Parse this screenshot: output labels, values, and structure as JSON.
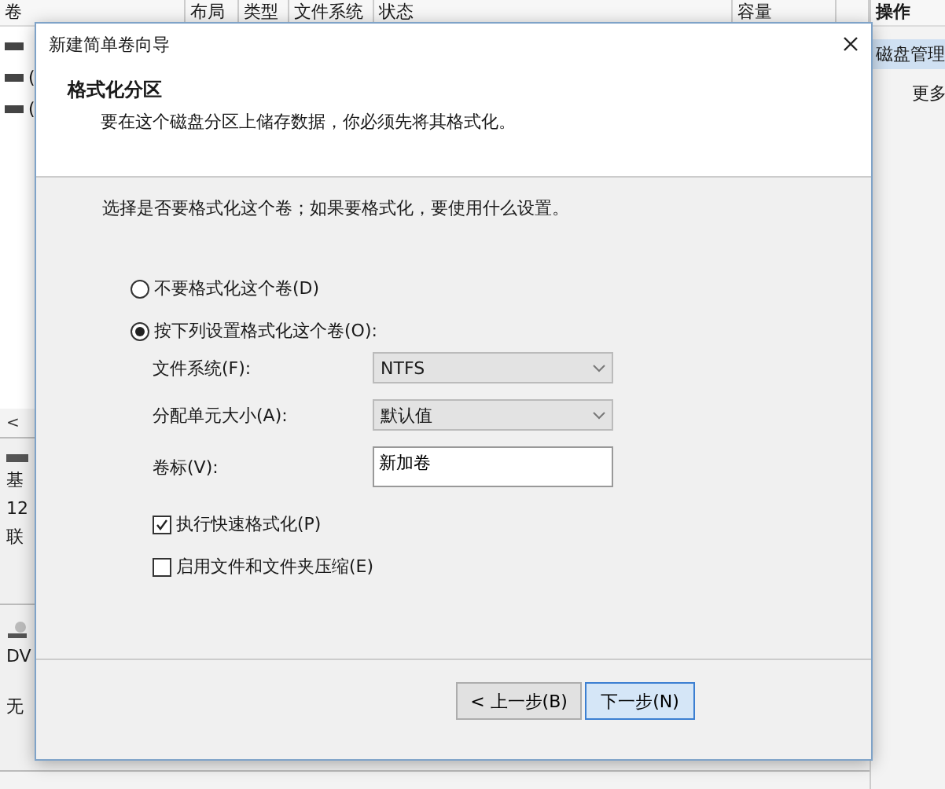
{
  "background": {
    "columns": [
      {
        "label": "卷"
      },
      {
        "label": "布局"
      },
      {
        "label": "类型"
      },
      {
        "label": "文件系统"
      },
      {
        "label": "状态"
      },
      {
        "label": "容量"
      }
    ],
    "actions_header": "操作",
    "actions": [
      {
        "label": "磁盘管理",
        "selected": true
      },
      {
        "label": "更多",
        "selected": false
      }
    ],
    "volumes": [
      {
        "kind": "volume"
      },
      {
        "kind": "volume",
        "text": "("
      },
      {
        "kind": "volume",
        "text": "("
      }
    ],
    "scroll_left": "<",
    "disks": [
      {
        "kind": "disk",
        "lines": [
          "基",
          "12",
          "联"
        ]
      },
      {
        "kind": "dvd",
        "lines": [
          "DV",
          "无"
        ]
      }
    ]
  },
  "dialog": {
    "title": "新建简单卷向导",
    "heading": "格式化分区",
    "subheading": "要在这个磁盘分区上储存数据，你必须先将其格式化。",
    "prompt": "选择是否要格式化这个卷；如果要格式化，要使用什么设置。",
    "format_options": [
      {
        "label": "不要格式化这个卷(D)",
        "selected": false
      },
      {
        "label": "按下列设置格式化这个卷(O):",
        "selected": true
      }
    ],
    "fields": [
      {
        "kind": "select",
        "label": "文件系统(F):",
        "value": "NTFS"
      },
      {
        "kind": "select",
        "label": "分配单元大小(A):",
        "value": "默认值"
      },
      {
        "kind": "text",
        "label": "卷标(V):",
        "value": "新加卷"
      }
    ],
    "checkboxes": [
      {
        "label": "执行快速格式化(P)",
        "checked": true
      },
      {
        "label": "启用文件和文件夹压缩(E)",
        "checked": false
      }
    ],
    "buttons": [
      {
        "label": "< 上一步(B)",
        "focused": false
      },
      {
        "label": "下一步(N)",
        "focused": true
      }
    ]
  }
}
